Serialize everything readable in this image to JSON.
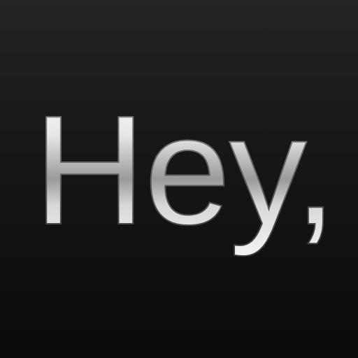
{
  "icon": {
    "greeting": "Hey,"
  },
  "colors": {
    "background_top": "#242424",
    "background_bottom": "#0b0b0b",
    "chrome_light": "#ffffff",
    "chrome_mid": "#bdbdbd",
    "chrome_dark": "#6e6e6e"
  }
}
